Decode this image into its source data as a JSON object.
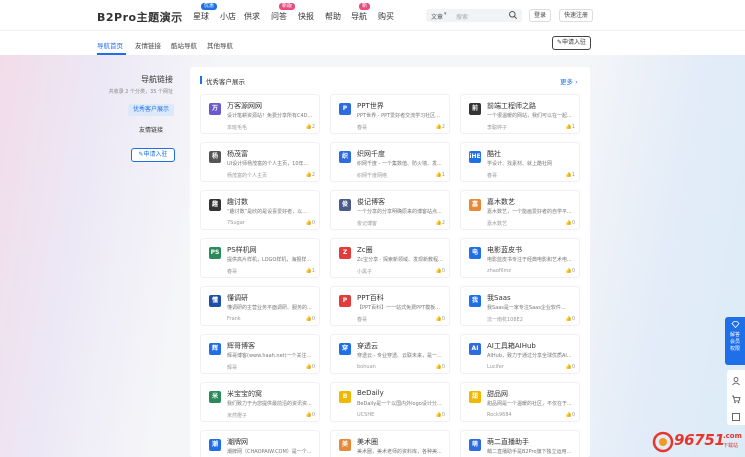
{
  "header": {
    "logo": "B2Pro主题演示",
    "nav": [
      {
        "label": "星球",
        "badge": "优惠",
        "badge_color": "#1e6fe8"
      },
      {
        "label": "小店",
        "badge": "",
        "badge_color": ""
      },
      {
        "label": "供求",
        "badge": "",
        "badge_color": ""
      },
      {
        "label": "问答",
        "badge": "新版",
        "badge_color": "#e94c7b"
      },
      {
        "label": "快报",
        "badge": "",
        "badge_color": ""
      },
      {
        "label": "帮助",
        "badge": "",
        "badge_color": ""
      },
      {
        "label": "导航",
        "badge": "新",
        "badge_color": "#e94c7b"
      },
      {
        "label": "购买",
        "badge": "",
        "badge_color": ""
      }
    ],
    "search": {
      "category": "文章",
      "placeholder": "搜索"
    },
    "login_label": "登录",
    "register_label": "快速注册"
  },
  "subnav": {
    "items": [
      "导航首页",
      "友情链接",
      "酷站导航",
      "其他导航"
    ],
    "active_index": 0,
    "apply_label": "申请入驻"
  },
  "left_panel": {
    "title": "导航链接",
    "subtitle": "共收录 2 个分类，35 个网址",
    "items": [
      "优秀客户展示",
      "友情链接"
    ],
    "apply_label": "申请入驻"
  },
  "main": {
    "section_title": "优秀客户展示",
    "more_label": "更多 ›",
    "cards": [
      {
        "name": "万客源网网",
        "desc": "设计笔耕资源站！免费分享所有C4D...",
        "author": "本班毛毛",
        "likes": "2",
        "icon_color": "#6a5acd",
        "icon_text": "万"
      },
      {
        "name": "PPT世界",
        "desc": "PPT世界 - PPT爱好者交流学习社区...",
        "author": "春哥",
        "likes": "2",
        "icon_color": "#2d6be0",
        "icon_text": "P"
      },
      {
        "name": "前端工程师之路",
        "desc": "一个很温暖的网站，我们可以在一起...",
        "author": "李聪婷子",
        "likes": "1",
        "icon_color": "#333333",
        "icon_text": "前"
      },
      {
        "name": "杨茂富",
        "desc": "UI设计师杨茂富的个人主页，10年...",
        "author": "杨茂富的个人主页",
        "likes": "2",
        "icon_color": "#555555",
        "icon_text": "杨"
      },
      {
        "name": "织网千度",
        "desc": "织网千度 - 一个集数值、防火墙、发...",
        "author": "织网千度网络",
        "likes": "1",
        "icon_color": "#2d6be0",
        "icon_text": "织"
      },
      {
        "name": "酷社",
        "desc": "学设计、找素材、就上酷社网",
        "author": "春哥",
        "likes": "1",
        "icon_color": "#1e6fe8",
        "icon_text": "iHE"
      },
      {
        "name": "趣讨数",
        "desc": "“趣讨数”是欣的是设喜爱好者，以...",
        "author": "7Sugar",
        "likes": "0",
        "icon_color": "#333333",
        "icon_text": "趣"
      },
      {
        "name": "俊记博客",
        "desc": "一个分享的分享明确原来的博客站点...",
        "author": "俊记博客",
        "likes": "2",
        "icon_color": "#4a5a8a",
        "icon_text": "俊"
      },
      {
        "name": "嘉木数艺",
        "desc": "嘉木数艺，一个能画爱好者的自学平...",
        "author": "嘉木数艺",
        "likes": "0",
        "icon_color": "#e68a3a",
        "icon_text": "嘉"
      },
      {
        "name": "PS样机网",
        "desc": "提供高片样机，LOGO样机，海报样...",
        "author": "春哥",
        "likes": "1",
        "icon_color": "#2c8a5a",
        "icon_text": "PS"
      },
      {
        "name": "Zc圈",
        "desc": "Zc宝分享 · 探索新领域、发现新教程...",
        "author": "小黑子",
        "likes": "0",
        "icon_color": "#e33a3a",
        "icon_text": "Z"
      },
      {
        "name": "电影蓝皮书",
        "desc": "电影蓝皮书专注于经典电影和艺术电...",
        "author": "zhaofilmz",
        "likes": "0",
        "icon_color": "#1e6fe8",
        "icon_text": "电"
      },
      {
        "name": "懂调研",
        "desc": "懂调研的主营业务平面调研、服务的...",
        "author": "Frank",
        "likes": "0",
        "icon_color": "#1e4fa8",
        "icon_text": "懂"
      },
      {
        "name": "PPT百科",
        "desc": "【PPT百科】一一站式免费PPT模板...",
        "author": "春哥",
        "likes": "0",
        "icon_color": "#e33a3a",
        "icon_text": "P"
      },
      {
        "name": "我Saas",
        "desc": "我Saas是一家专注Saas企业软件...",
        "author": "沈一南杭108E2",
        "likes": "0",
        "icon_color": "#1e6fe8",
        "icon_text": "我"
      },
      {
        "name": "辉哥博客",
        "desc": "辉哥博客(www.haah.net)一个关注...",
        "author": "辉哥",
        "likes": "0",
        "icon_color": "#1e6fe8",
        "icon_text": "辉"
      },
      {
        "name": "穿透云",
        "desc": "穿透云 - 专业穿透、云联未来，是一...",
        "author": "bohuan",
        "likes": "0",
        "icon_color": "#1e6fe8",
        "icon_text": "穿"
      },
      {
        "name": "AI工具箱AIHub",
        "desc": "AIHub，致力于通过分享全球优质AI...",
        "author": "Lucifer",
        "likes": "0",
        "icon_color": "#2d6be0",
        "icon_text": "AI"
      },
      {
        "name": "米宝宝的窝",
        "desc": "我们致力于为您提供最前沿的资讯资...",
        "author": "米然橙子",
        "likes": "0",
        "icon_color": "#2c8a5a",
        "icon_text": "米"
      },
      {
        "name": "BeDaily",
        "desc": "BeDaily是一个以国内外logo设计分...",
        "author": "UCSHE",
        "likes": "0",
        "icon_color": "#f0b800",
        "icon_text": "B"
      },
      {
        "name": "甜品网",
        "desc": "甜品网是一个温暖的社区，不仅在于...",
        "author": "Rock9684",
        "likes": "0",
        "icon_color": "#f0b800",
        "icon_text": "甜"
      },
      {
        "name": "潮牌网",
        "desc": "潮牌网（CHAOPAIW.COM）是一个...",
        "author": "",
        "likes": "0",
        "icon_color": "#1e6fe8",
        "icon_text": "潮"
      },
      {
        "name": "美术圈",
        "desc": "美术圈，美术老师的资料库，各种美...",
        "author": "",
        "likes": "",
        "icon_color": "#e68a3a",
        "icon_text": "美"
      },
      {
        "name": "萌二直播助手",
        "desc": "萌二直播助手是B2Pro旗下独立运用...",
        "author": "",
        "likes": "",
        "icon_color": "#2d6be0",
        "icon_text": "萌"
      }
    ]
  },
  "float_panel": {
    "label": "解答会员权限"
  },
  "watermark": {
    "number": "96751",
    "suffix": ".com",
    "sub": "下载站"
  }
}
